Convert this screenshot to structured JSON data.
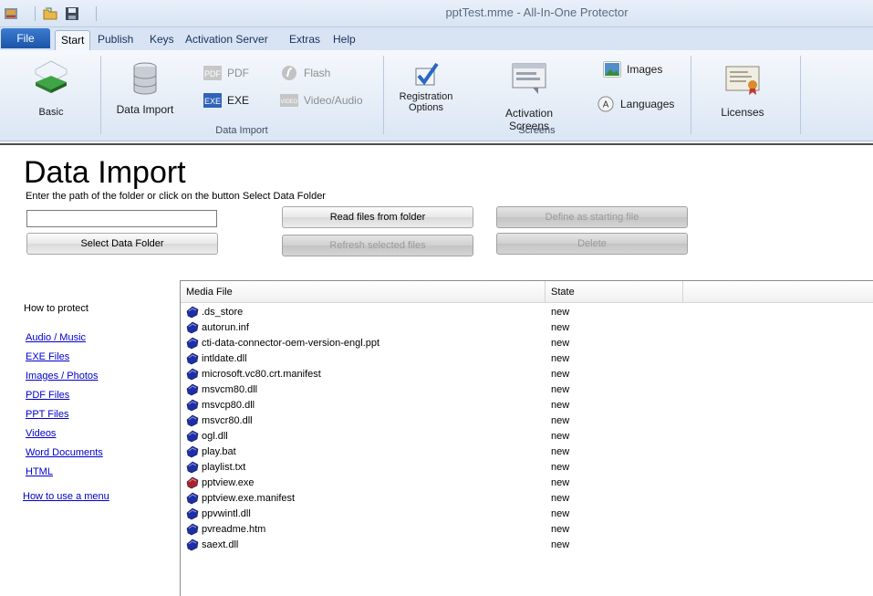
{
  "window": {
    "title": "pptTest.mme - All-In-One Protector"
  },
  "tabs": {
    "file": "File",
    "items": [
      "Start",
      "Publish",
      "Keys",
      "Activation Server",
      "Extras",
      "Help"
    ]
  },
  "ribbon": {
    "basic": "Basic",
    "data_import": "Data Import",
    "pdf": "PDF",
    "exe": "EXE",
    "flash": "Flash",
    "video_audio": "Video/Audio",
    "group_data_import": "Data Import",
    "registration_line1": "Registration",
    "registration_line2": "Options",
    "activation_screens": "Activation Screens",
    "images": "Images",
    "languages": "Languages",
    "group_screens": "Screens",
    "licenses": "Licenses"
  },
  "main": {
    "title": "Data Import",
    "instruction": "Enter the path of the folder or click on the button Select Data Folder",
    "path_value": "",
    "buttons": {
      "select_folder": "Select Data Folder",
      "read_files": "Read files from folder",
      "refresh_selected": "Refresh selected files",
      "define_start": "Define as starting file",
      "delete": "Delete"
    }
  },
  "left": {
    "heading": "How to protect",
    "links": [
      "Audio / Music",
      "EXE Files",
      "Images / Photos",
      "PDF Files",
      "PPT Files",
      "Videos",
      "Word Documents",
      "HTML"
    ],
    "menu_link": "How to use a menu"
  },
  "table": {
    "columns": [
      "Media File",
      "State"
    ],
    "rows": [
      {
        "file": ".ds_store",
        "state": "new",
        "icon": "blue-file-icon"
      },
      {
        "file": "autorun.inf",
        "state": "new",
        "icon": "blue-file-icon"
      },
      {
        "file": "cti-data-connector-oem-version-engl.ppt",
        "state": "new",
        "icon": "blue-file-icon"
      },
      {
        "file": "intldate.dll",
        "state": "new",
        "icon": "blue-file-icon"
      },
      {
        "file": "microsoft.vc80.crt.manifest",
        "state": "new",
        "icon": "blue-file-icon"
      },
      {
        "file": "msvcm80.dll",
        "state": "new",
        "icon": "blue-file-icon"
      },
      {
        "file": "msvcp80.dll",
        "state": "new",
        "icon": "blue-file-icon"
      },
      {
        "file": "msvcr80.dll",
        "state": "new",
        "icon": "blue-file-icon"
      },
      {
        "file": "ogl.dll",
        "state": "new",
        "icon": "blue-file-icon"
      },
      {
        "file": "play.bat",
        "state": "new",
        "icon": "blue-file-icon"
      },
      {
        "file": "playlist.txt",
        "state": "new",
        "icon": "blue-file-icon"
      },
      {
        "file": "pptview.exe",
        "state": "new",
        "icon": "red-file-icon"
      },
      {
        "file": "pptview.exe.manifest",
        "state": "new",
        "icon": "blue-file-icon"
      },
      {
        "file": "ppvwintl.dll",
        "state": "new",
        "icon": "blue-file-icon"
      },
      {
        "file": "pvreadme.htm",
        "state": "new",
        "icon": "blue-file-icon"
      },
      {
        "file": "saext.dll",
        "state": "new",
        "icon": "blue-file-icon"
      }
    ]
  },
  "colors": {
    "file_blue": "#1c2ea8",
    "file_red": "#b0202a",
    "link": "#0000cc"
  }
}
